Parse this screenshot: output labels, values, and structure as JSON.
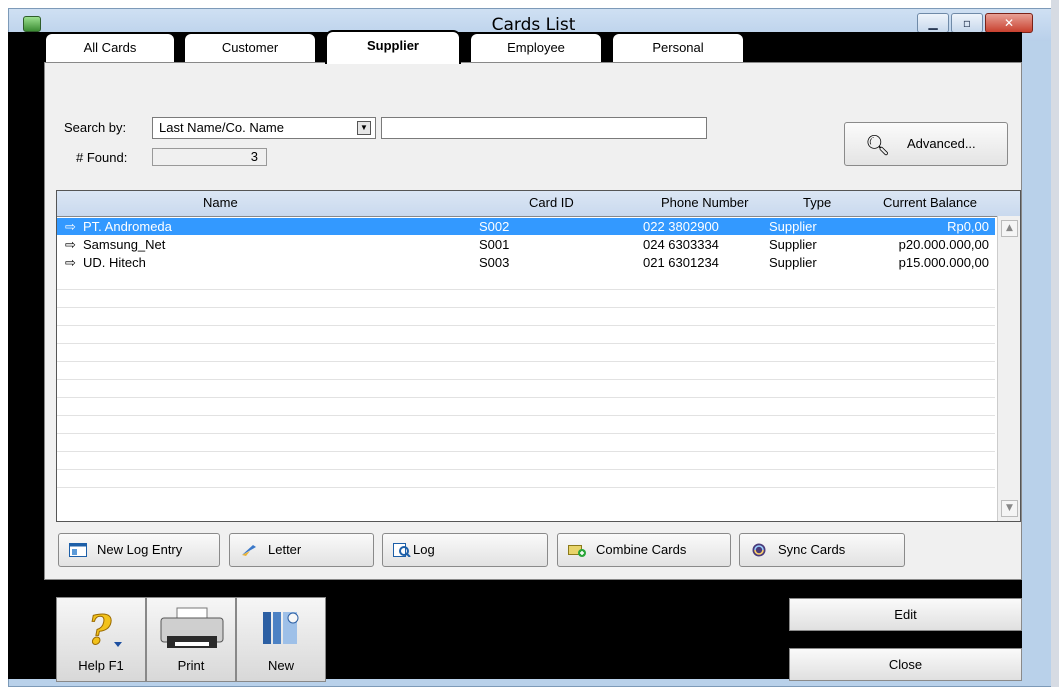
{
  "window": {
    "title": "Cards List",
    "min_icon": "minimize-icon",
    "max_icon": "maximize-icon",
    "close_icon": "close-icon"
  },
  "tabs": [
    {
      "label": "All Cards"
    },
    {
      "label": "Customer"
    },
    {
      "label": "Supplier"
    },
    {
      "label": "Employee"
    },
    {
      "label": "Personal"
    }
  ],
  "search": {
    "by_label": "Search by:",
    "by_value": "Last Name/Co. Name",
    "text_value": "",
    "found_label": "# Found:",
    "found_value": "3",
    "advanced_label": "Advanced..."
  },
  "grid": {
    "columns": [
      "Name",
      "Card ID",
      "Phone Number",
      "Type",
      "Current Balance"
    ],
    "rows": [
      {
        "arrow": "⇨",
        "name": "PT. Andromeda",
        "card_id": "S002",
        "phone": "022 3802900",
        "type": "Supplier",
        "balance": "Rp0,00"
      },
      {
        "arrow": "⇨",
        "name": "Samsung_Net",
        "card_id": "S001",
        "phone": "024 6303334",
        "type": "Supplier",
        "balance": "p20.000.000,00"
      },
      {
        "arrow": "⇨",
        "name": "UD. Hitech",
        "card_id": "S003",
        "phone": "021 6301234",
        "type": "Supplier",
        "balance": "p15.000.000,00"
      }
    ]
  },
  "actions": {
    "new_log": "New Log Entry",
    "letter": "Letter",
    "log": "Log",
    "combine": "Combine Cards",
    "sync": "Sync Cards"
  },
  "toolbar": {
    "help": "Help F1",
    "print": "Print",
    "new": "New"
  },
  "buttons": {
    "edit": "Edit",
    "close": "Close"
  },
  "colors": {
    "selection": "#3399ff",
    "title_bg": "#b9d1ea"
  }
}
